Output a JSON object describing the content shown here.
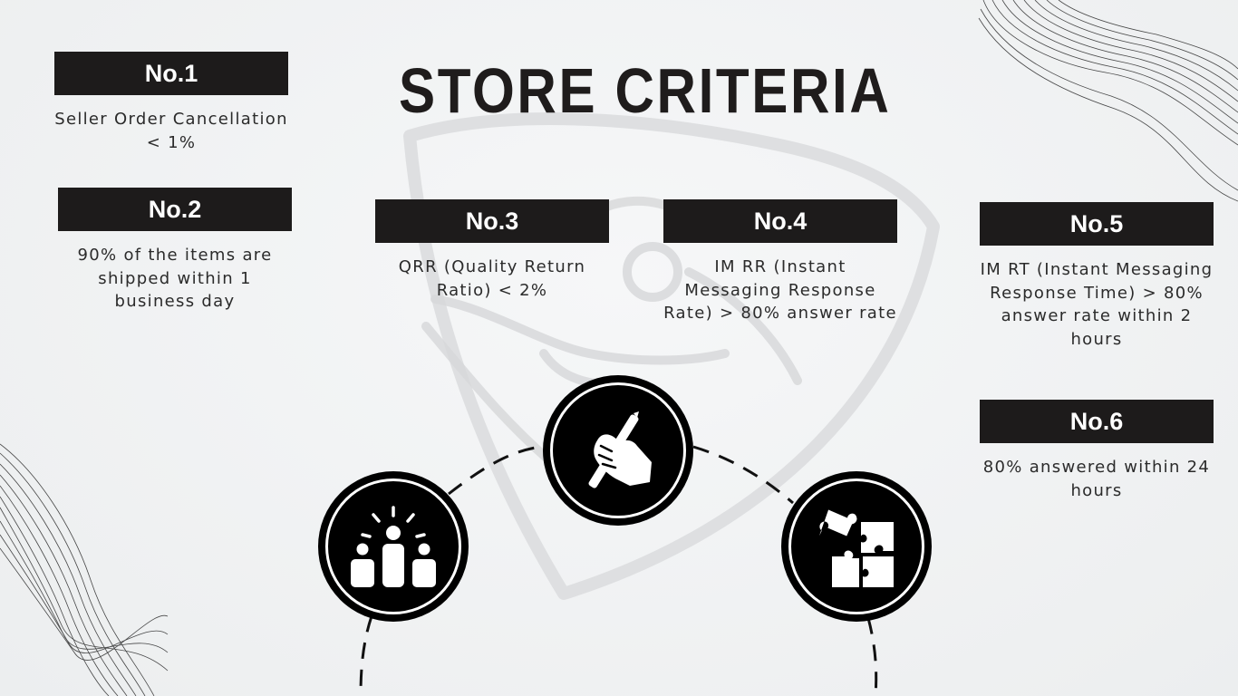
{
  "slide": {
    "title": "STORE CRITERIA",
    "criteria": [
      {
        "label": "No.1",
        "text": "Seller Order Cancellation < 1%"
      },
      {
        "label": "No.2",
        "text": "90% of the items are shipped within 1 business day"
      },
      {
        "label": "No.3",
        "text": "QRR (Quality Return Ratio) < 2%"
      },
      {
        "label": "No.4",
        "text": "IM RR (Instant Messaging Response Rate) > 80% answer rate"
      },
      {
        "label": "No.5",
        "text": "IM RT (Instant Messaging Response Time) > 80% answer rate within 2 hours"
      },
      {
        "label": "No.6",
        "text": "80% answered within 24 hours"
      }
    ],
    "icons": [
      "team-icon",
      "hand-pen-icon",
      "puzzle-icon",
      "handshake-shield-watermark-icon",
      "wave-lines-decoration-icon"
    ]
  },
  "colors": {
    "badge": "#1d1b1b",
    "badge_text": "#ffffff",
    "background": "#f3f4f5",
    "body_text": "#2b2b2b"
  }
}
